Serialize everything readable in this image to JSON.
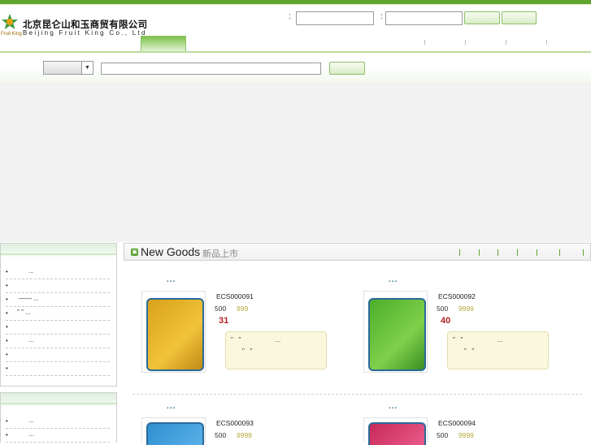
{
  "header": {
    "company_cn": "北京昆仑山和玉商贸有限公司",
    "company_en": "Beijing Fruit King Co., Ltd",
    "logo_small": "Fruit King",
    "colon1": ":",
    "colon2": ":"
  },
  "section": {
    "title_en": "New Goods",
    "title_cn": "新品上市",
    "icon": "new-goods-icon"
  },
  "sidebar1": {
    "items": [
      {
        "bullet": "•",
        "text": "..."
      },
      {
        "bullet": "•",
        "text": ""
      },
      {
        "bullet": "•",
        "text": "——   ..."
      },
      {
        "bullet": "•",
        "text": "\" \"   ..."
      },
      {
        "bullet": "•",
        "text": ""
      },
      {
        "bullet": "•",
        "text": "..."
      },
      {
        "bullet": "•",
        "text": ""
      },
      {
        "bullet": "•",
        "text": ""
      }
    ]
  },
  "sidebar2": {
    "items": [
      {
        "bullet": "•",
        "text": "..."
      },
      {
        "bullet": "•",
        "text": "..."
      }
    ]
  },
  "products": [
    {
      "name": "...",
      "sku": "ECS000091",
      "price": "500",
      "market": "999",
      "qty": "31",
      "note1": "\"   \"                   ...",
      "note2": "\"   \""
    },
    {
      "name": "...",
      "sku": "ECS000092",
      "price": "500",
      "market": "9999",
      "qty": "40",
      "note1": "\"   \"                   ...",
      "note2": "\"   \""
    },
    {
      "name": "...",
      "sku": "ECS000093",
      "price": "500",
      "market": "9999"
    },
    {
      "name": "...",
      "sku": "ECS000094",
      "price": "500",
      "market": "9999"
    }
  ],
  "colors": {
    "accent": "#5fa630",
    "qty": "#b22222",
    "market_price": "#b2a83a"
  }
}
